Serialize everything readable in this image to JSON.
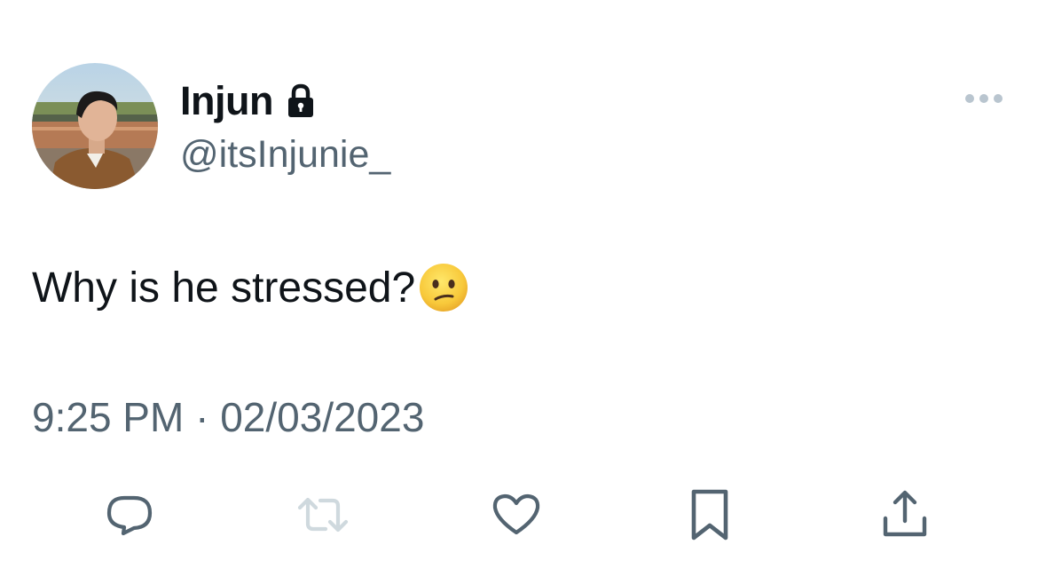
{
  "author": {
    "display_name": "Injun",
    "handle": "@itsInjunie_",
    "protected": true,
    "avatar_icon": "profile-photo"
  },
  "tweet": {
    "text": "Why is he stressed?",
    "emoji": "confused-face",
    "time": "9:25 PM",
    "separator": "·",
    "date": "02/03/2023"
  },
  "actions": [
    {
      "name": "reply",
      "icon": "reply-bubble-icon"
    },
    {
      "name": "retweet",
      "icon": "retweet-icon",
      "disabled": true
    },
    {
      "name": "like",
      "icon": "heart-icon"
    },
    {
      "name": "bookmark",
      "icon": "bookmark-icon"
    },
    {
      "name": "share",
      "icon": "share-icon"
    }
  ],
  "colors": {
    "text_primary": "#0f1419",
    "text_secondary": "#536471",
    "icon": "#536471",
    "icon_disabled": "#cfd9de"
  }
}
